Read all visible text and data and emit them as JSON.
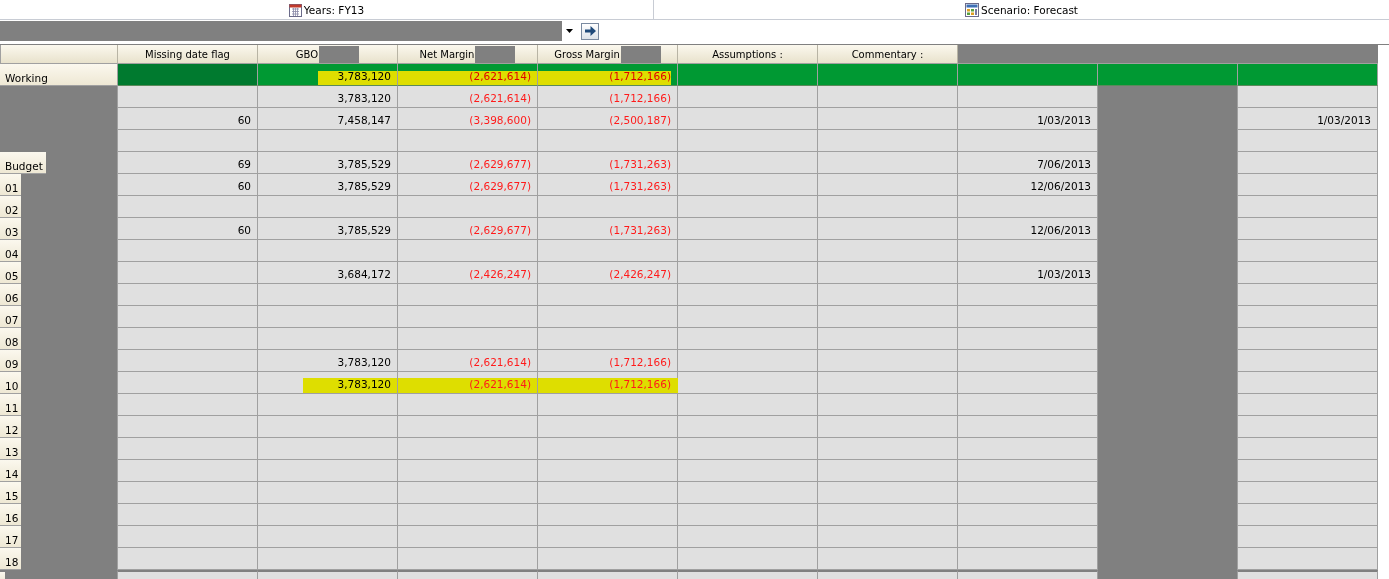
{
  "pov": [
    {
      "label": "Years: FY13",
      "kind": "calendar"
    },
    {
      "label": "Scenario: Forecast",
      "kind": "scenario"
    }
  ],
  "member_bar": {
    "redacted": true
  },
  "columns": [
    {
      "label": "Missing date flag",
      "redacted": false
    },
    {
      "label": "GBO",
      "redacted": true
    },
    {
      "label": "Net Margin",
      "redacted": true,
      "negative": true
    },
    {
      "label": "Gross Margin",
      "redacted": true,
      "negative": true
    },
    {
      "label": "Assumptions :",
      "redacted": false
    },
    {
      "label": "Commentary :",
      "redacted": false
    },
    {
      "redacted": true
    },
    {
      "redacted": true,
      "hidden_body": true
    },
    {
      "redacted": true
    }
  ],
  "rows": [
    {
      "label": "Working",
      "kind": "working",
      "highlighted": true,
      "cells": [
        null,
        "3,783,120",
        "(2,621,614)",
        "(1,712,166)",
        null,
        null,
        null,
        null,
        null
      ]
    },
    {
      "kind": "data",
      "highlighted": false,
      "cells": [
        null,
        "3,783,120",
        "(2,621,614)",
        "(1,712,166)",
        null,
        null,
        null,
        null,
        null
      ]
    },
    {
      "kind": "data",
      "highlighted": false,
      "cells": [
        "60",
        "7,458,147",
        "(3,398,600)",
        "(2,500,187)",
        null,
        null,
        "1/03/2013",
        null,
        "1/03/2013"
      ]
    },
    {
      "kind": "data",
      "highlighted": false,
      "cells": [
        null,
        null,
        null,
        null,
        null,
        null,
        null,
        null,
        null
      ]
    },
    {
      "label": "Budget",
      "kind": "data",
      "highlighted": false,
      "cells": [
        "69",
        "3,785,529",
        "(2,629,677)",
        "(1,731,263)",
        null,
        null,
        "7/06/2013",
        null,
        null
      ]
    },
    {
      "label": "01",
      "kind": "data",
      "highlighted": false,
      "cells": [
        "60",
        "3,785,529",
        "(2,629,677)",
        "(1,731,263)",
        null,
        null,
        "12/06/2013",
        null,
        null
      ]
    },
    {
      "label": "02",
      "kind": "data",
      "highlighted": false,
      "cells": [
        null,
        null,
        null,
        null,
        null,
        null,
        null,
        null,
        null
      ]
    },
    {
      "label": "03",
      "kind": "data",
      "highlighted": false,
      "cells": [
        "60",
        "3,785,529",
        "(2,629,677)",
        "(1,731,263)",
        null,
        null,
        "12/06/2013",
        null,
        null
      ]
    },
    {
      "label": "04",
      "kind": "data",
      "highlighted": false,
      "cells": [
        null,
        null,
        null,
        null,
        null,
        null,
        null,
        null,
        null
      ]
    },
    {
      "label": "05",
      "kind": "data",
      "highlighted": false,
      "cells": [
        null,
        "3,684,172",
        "(2,426,247)",
        "(2,426,247)",
        null,
        null,
        "1/03/2013",
        null,
        null
      ]
    },
    {
      "label": "06",
      "kind": "data",
      "highlighted": false,
      "cells": [
        null,
        null,
        null,
        null,
        null,
        null,
        null,
        null,
        null
      ]
    },
    {
      "label": "07",
      "kind": "data",
      "highlighted": false,
      "cells": [
        null,
        null,
        null,
        null,
        null,
        null,
        null,
        null,
        null
      ]
    },
    {
      "label": "08",
      "kind": "data",
      "highlighted": false,
      "cells": [
        null,
        null,
        null,
        null,
        null,
        null,
        null,
        null,
        null
      ]
    },
    {
      "label": "09",
      "kind": "data",
      "highlighted": false,
      "cells": [
        null,
        "3,783,120",
        "(2,621,614)",
        "(1,712,166)",
        null,
        null,
        null,
        null,
        null
      ]
    },
    {
      "label": "10",
      "kind": "data",
      "highlighted": true,
      "cells": [
        null,
        "3,783,120",
        "(2,621,614)",
        "(1,712,166)",
        null,
        null,
        null,
        null,
        null
      ]
    },
    {
      "label": "11",
      "kind": "data",
      "highlighted": false,
      "cells": [
        null,
        null,
        null,
        null,
        null,
        null,
        null,
        null,
        null
      ]
    },
    {
      "label": "12",
      "kind": "data",
      "highlighted": false,
      "cells": [
        null,
        null,
        null,
        null,
        null,
        null,
        null,
        null,
        null
      ]
    },
    {
      "label": "13",
      "kind": "data",
      "highlighted": false,
      "cells": [
        null,
        null,
        null,
        null,
        null,
        null,
        null,
        null,
        null
      ]
    },
    {
      "label": "14",
      "kind": "data",
      "highlighted": false,
      "cells": [
        null,
        null,
        null,
        null,
        null,
        null,
        null,
        null,
        null
      ]
    },
    {
      "label": "15",
      "kind": "data",
      "highlighted": false,
      "cells": [
        null,
        null,
        null,
        null,
        null,
        null,
        null,
        null,
        null
      ]
    },
    {
      "label": "16",
      "kind": "data",
      "highlighted": false,
      "cells": [
        null,
        null,
        null,
        null,
        null,
        null,
        null,
        null,
        null
      ]
    },
    {
      "label": "17",
      "kind": "data",
      "highlighted": false,
      "cells": [
        null,
        null,
        null,
        null,
        null,
        null,
        null,
        null,
        null
      ]
    },
    {
      "label": "18",
      "kind": "data",
      "highlighted": false,
      "cells": [
        null,
        null,
        null,
        null,
        null,
        null,
        null,
        null,
        null
      ]
    }
  ]
}
